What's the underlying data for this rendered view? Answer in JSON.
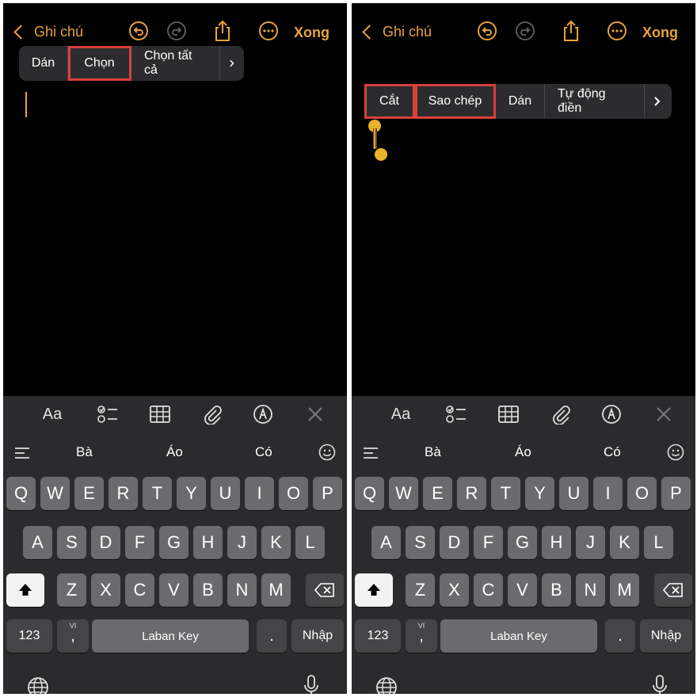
{
  "nav": {
    "back_label": "Ghi chú",
    "done_label": "Xong"
  },
  "left": {
    "menu": [
      "Dán",
      "Chọn",
      "Chọn tất cả"
    ]
  },
  "right": {
    "menu": [
      "Cắt",
      "Sao chép",
      "Dán",
      "Tự động điền"
    ]
  },
  "toolbar": {
    "format_label": "Aa"
  },
  "suggestions": [
    "Bà",
    "Áo",
    "Có"
  ],
  "keys": {
    "row1": [
      "Q",
      "W",
      "E",
      "R",
      "T",
      "Y",
      "U",
      "I",
      "O",
      "P"
    ],
    "row2": [
      "A",
      "S",
      "D",
      "F",
      "G",
      "H",
      "J",
      "K",
      "L"
    ],
    "row3": [
      "Z",
      "X",
      "C",
      "V",
      "B",
      "N",
      "M"
    ],
    "numbers": "123",
    "comma": ",",
    "lang_small": "VI",
    "space": "Laban Key",
    "period": ".",
    "return": "Nhập"
  },
  "colors": {
    "accent": "#e8a23a",
    "highlight": "#d9403a",
    "keyboard_bg": "#2b2b2d",
    "key": "#6b6b6e"
  }
}
